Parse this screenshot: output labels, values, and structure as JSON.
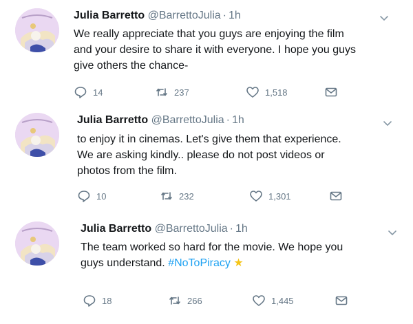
{
  "tweets": [
    {
      "name": "Julia Barretto",
      "handle": "@BarrettoJulia",
      "separator": "·",
      "time": "1h",
      "text_lines": [
        "We really appreciate that you guys are enjoying the film",
        "and your desire to share it with everyone. I hope you guys",
        "give others the chance-"
      ],
      "replies": "14",
      "retweets": "237",
      "likes": "1,518"
    },
    {
      "name": "Julia Barretto",
      "handle": "@BarrettoJulia",
      "separator": "·",
      "time": "1h",
      "text_lines": [
        "to enjoy it in cinemas. Let's give them that experience.",
        "We are asking kindly.. please do not post videos or",
        "photos from the film."
      ],
      "replies": "10",
      "retweets": "232",
      "likes": "1,301"
    },
    {
      "name": "Julia Barretto",
      "handle": "@BarrettoJulia",
      "separator": "·",
      "time": "1h",
      "text_lines": [
        "The team worked so hard for the movie. We hope you",
        "guys understand."
      ],
      "hashtag": "#NoToPiracy",
      "emoji": "★",
      "replies": "18",
      "retweets": "266",
      "likes": "1,445"
    }
  ],
  "colors": {
    "text": "#14171a",
    "muted": "#657786",
    "link": "#1da1f2",
    "star": "#f5c518"
  },
  "icons": [
    "reply-icon",
    "retweet-icon",
    "like-icon",
    "direct-message-icon",
    "chevron-down-icon"
  ]
}
